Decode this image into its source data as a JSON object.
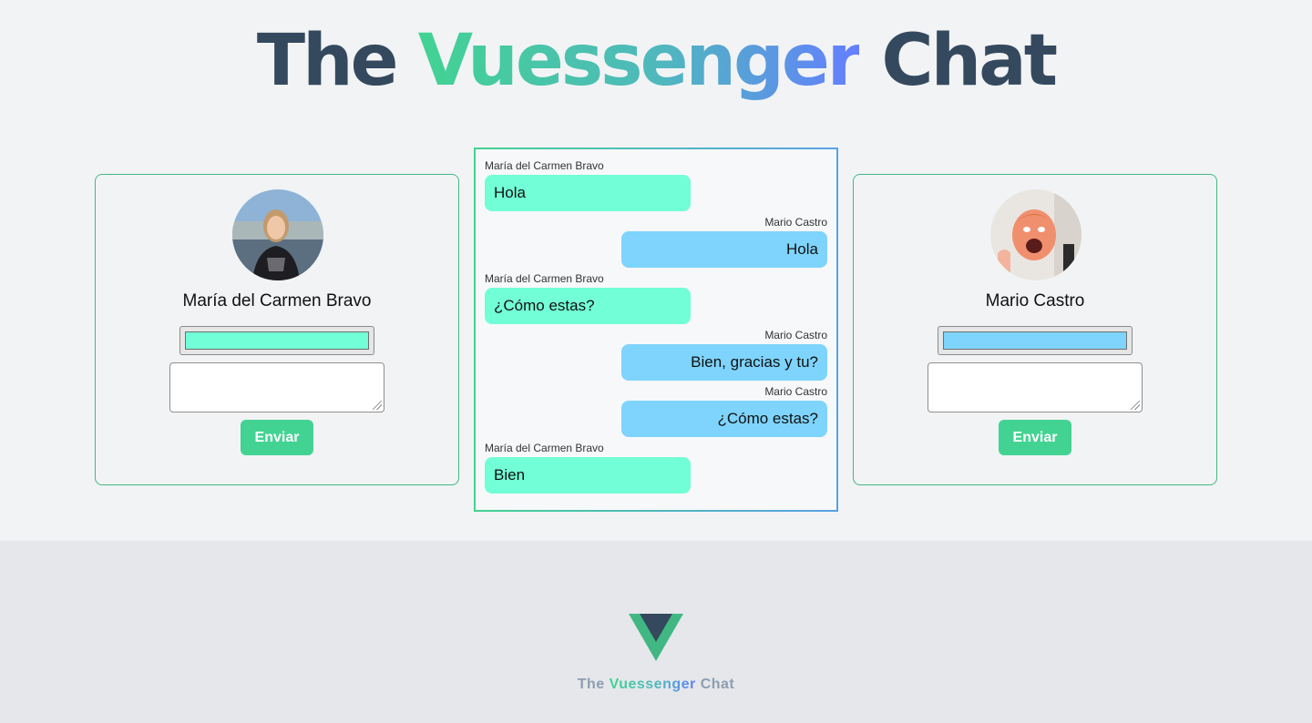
{
  "header": {
    "title_prefix": "The",
    "title_highlight": "Vuessenger",
    "title_suffix": "Chat"
  },
  "users": [
    {
      "name": "María del Carmen Bravo",
      "color": "#72fed6",
      "message_value": "",
      "send_label": "Enviar"
    },
    {
      "name": "Mario Castro",
      "color": "#7ed4fc",
      "message_value": "",
      "send_label": "Enviar"
    }
  ],
  "chat": {
    "messages": [
      {
        "author": "María del Carmen Bravo",
        "text": "Hola",
        "side": "left"
      },
      {
        "author": "Mario Castro",
        "text": "Hola",
        "side": "right"
      },
      {
        "author": "María del Carmen Bravo",
        "text": "¿Cómo estas?",
        "side": "left"
      },
      {
        "author": "Mario Castro",
        "text": "Bien, gracias y tu?",
        "side": "right"
      },
      {
        "author": "Mario Castro",
        "text": "¿Cómo estas?",
        "side": "right"
      },
      {
        "author": "María del Carmen Bravo",
        "text": "Bien",
        "side": "left"
      }
    ]
  },
  "footer": {
    "prefix": "The",
    "highlight": "Vuessenger",
    "suffix": "Chat"
  },
  "colors": {
    "accent_green": "#42d392",
    "accent_blue": "#647eff",
    "dark": "#35495e"
  }
}
